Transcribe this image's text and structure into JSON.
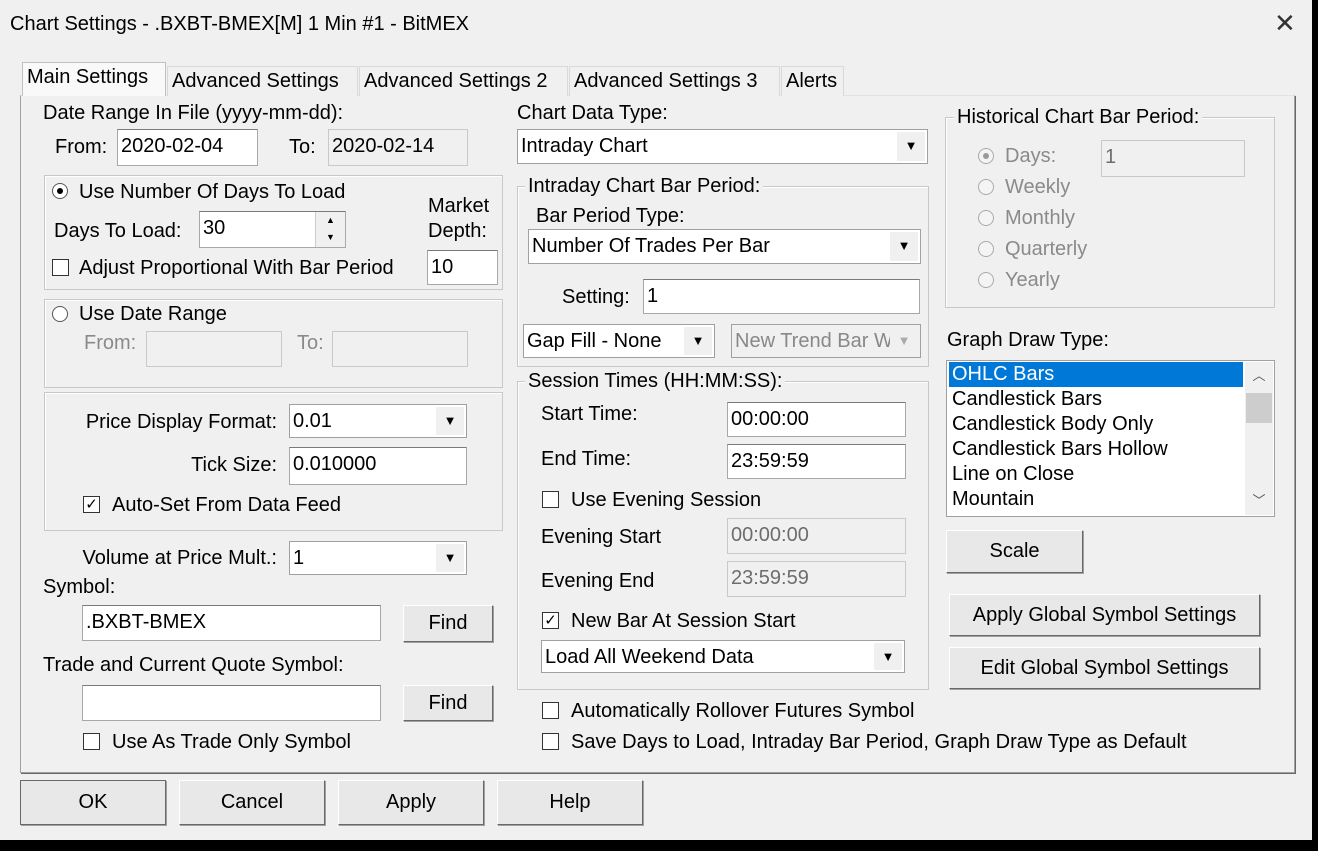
{
  "window": {
    "title": "Chart Settings - .BXBT-BMEX[M]  1 Min   #1 - BitMEX",
    "close": "✕"
  },
  "tabs": [
    "Main Settings",
    "Advanced Settings",
    "Advanced Settings 2",
    "Advanced Settings 3",
    "Alerts"
  ],
  "date_range": {
    "label": "Date Range In File (yyyy-mm-dd):",
    "from_label": "From:",
    "from": "2020-02-04",
    "to_label": "To:",
    "to": "2020-02-14"
  },
  "days": {
    "radio_label": "Use Number Of Days To Load",
    "days_label": "Days To Load:",
    "days_value": "30",
    "adjust_label": "Adjust Proportional With Bar Period",
    "market_depth_1": "Market",
    "market_depth_2": "Depth:",
    "market_depth_value": "10"
  },
  "use_date_range": {
    "radio_label": "Use Date Range",
    "from_label": "From:",
    "to_label": "To:"
  },
  "price": {
    "format_label": "Price Display Format:",
    "format_value": "0.01",
    "tick_label": "Tick Size:",
    "tick_value": "0.010000",
    "auto_label": "Auto-Set From Data Feed"
  },
  "vap": {
    "label": "Volume at Price Mult.:",
    "value": "1"
  },
  "symbol": {
    "label": "Symbol:",
    "value": ".BXBT-BMEX",
    "find": "Find",
    "trade_label": "Trade and Current Quote Symbol:",
    "trade_value": "",
    "find2": "Find",
    "trade_only_label": "Use As Trade Only Symbol"
  },
  "chart_type": {
    "label": "Chart Data Type:",
    "value": "Intraday Chart"
  },
  "intraday": {
    "group_label": "Intraday Chart Bar Period:",
    "type_label": "Bar Period Type:",
    "type_value": "Number Of Trades Per Bar",
    "setting_label": "Setting:",
    "setting_value": "1",
    "gap_fill": "Gap Fill - None",
    "new_trend": "New Trend Bar W"
  },
  "session": {
    "group_label": "Session Times (HH:MM:SS):",
    "start_label": "Start Time:",
    "start": "00:00:00",
    "end_label": "End Time:",
    "end": "23:59:59",
    "evening_label": "Use Evening Session",
    "ev_start_label": "Evening Start",
    "ev_start": "00:00:00",
    "ev_end_label": "Evening End",
    "ev_end": "23:59:59",
    "new_bar_label": "New Bar At Session Start",
    "weekend": "Load All Weekend Data"
  },
  "rollover_label": "Automatically Rollover Futures Symbol",
  "save_default_label": "Save Days to Load, Intraday Bar Period, Graph Draw Type as Default",
  "historical": {
    "group_label": "Historical Chart Bar Period:",
    "options": [
      "Days:",
      "Weekly",
      "Monthly",
      "Quarterly",
      "Yearly"
    ],
    "days_value": "1"
  },
  "graph": {
    "label": "Graph Draw Type:",
    "items": [
      "OHLC Bars",
      "Candlestick Bars",
      "Candlestick Body Only",
      "Candlestick Bars Hollow",
      "Line on Close",
      "Mountain"
    ]
  },
  "buttons": {
    "scale": "Scale",
    "apply_global": "Apply Global Symbol Settings",
    "edit_global": "Edit Global Symbol Settings",
    "ok": "OK",
    "cancel": "Cancel",
    "apply": "Apply",
    "help": "Help"
  },
  "colors": {
    "selection": "#0078d7"
  }
}
